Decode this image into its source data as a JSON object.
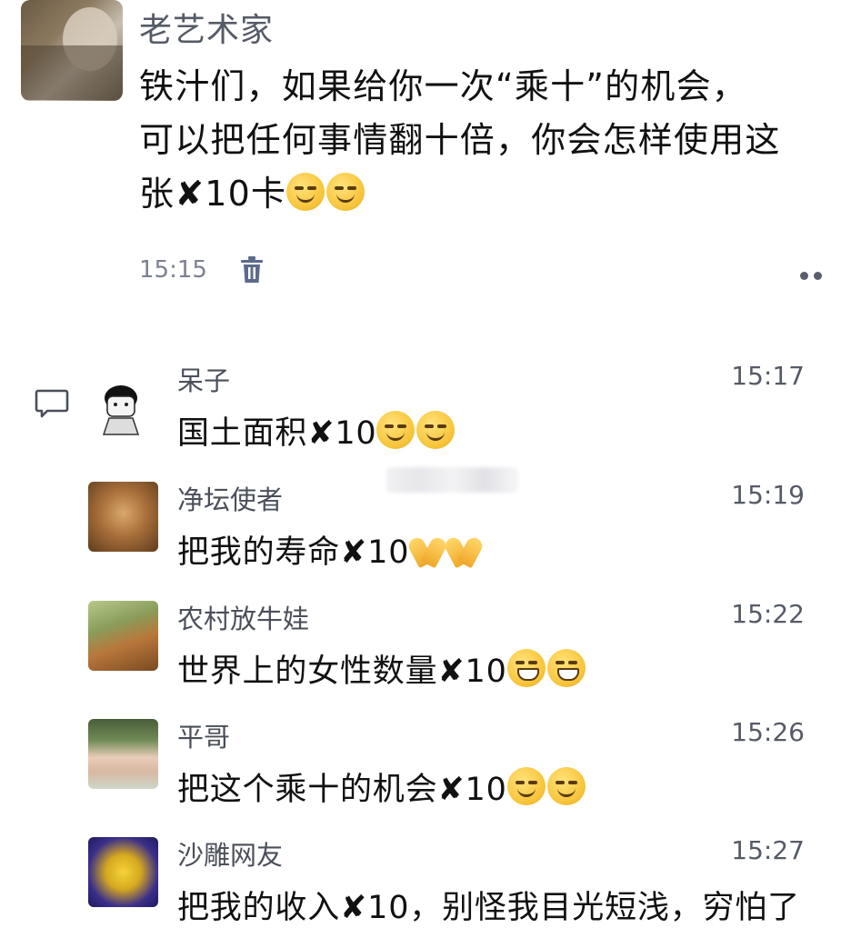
{
  "post": {
    "author": "老艺术家",
    "text_line1": "铁汁们，如果给你一次“乘十”的机会，",
    "text_line2": "可以把任何事情翻十倍，你会怎样使用这",
    "text_line3_prefix": "张",
    "text_line3_mult": "✘",
    "text_line3_suffix": "10卡",
    "time": "15:15"
  },
  "comments": [
    {
      "name": "呆子",
      "time": "15:17",
      "text": "国土面积",
      "mult": "✘",
      "num": "10",
      "emoji": "smirk"
    },
    {
      "name": "净坛使者",
      "time": "15:19",
      "text": "把我的寿命",
      "mult": "✘",
      "num": "10",
      "emoji": "pray"
    },
    {
      "name": "农村放牛娃",
      "time": "15:22",
      "text": "世界上的女性数量",
      "mult": "✘",
      "num": "10",
      "emoji": "grin"
    },
    {
      "name": "平哥",
      "time": "15:26",
      "text": "把这个乘十的机会",
      "mult": "✘",
      "num": "10",
      "emoji": "smirk"
    },
    {
      "name": "沙雕网友",
      "time": "15:27",
      "text": "把我的收入",
      "mult": "✘",
      "num": "10",
      "tail": "，别怪我目光短浅，穷怕了"
    }
  ],
  "icons": {
    "delete": "trash-icon",
    "more": "more-dots-icon",
    "comment": "comment-icon"
  }
}
